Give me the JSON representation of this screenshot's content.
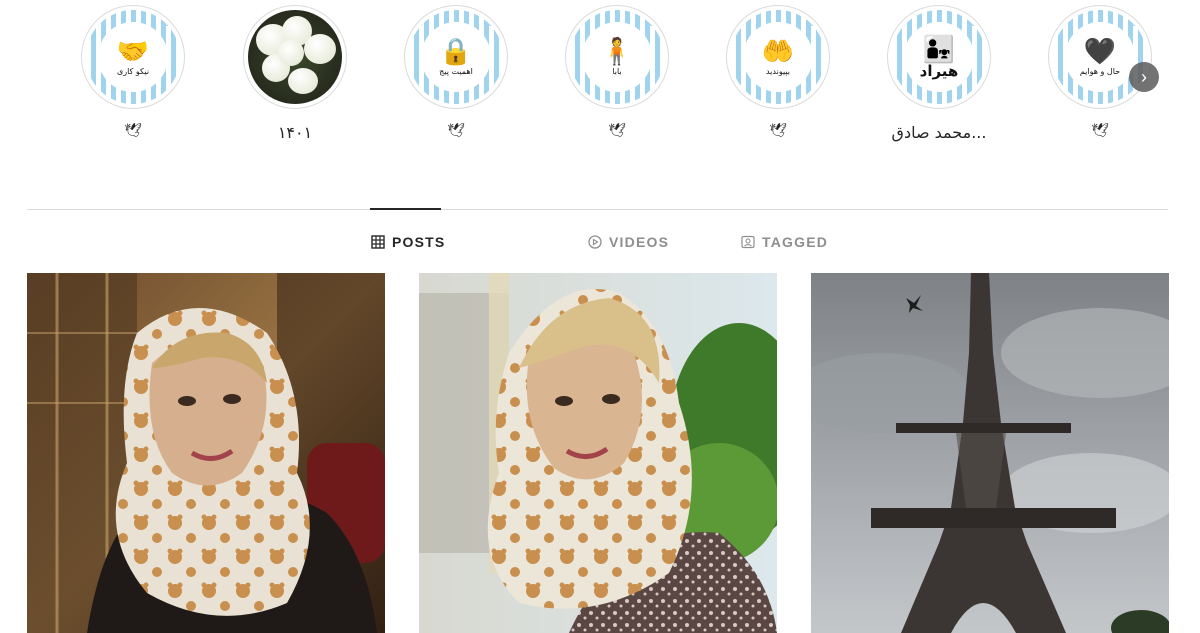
{
  "highlights": [
    {
      "label": "🕊",
      "icon": "handshake-icon",
      "glyph": "🤝",
      "sub": "نیکو کاری",
      "kind": "icon"
    },
    {
      "label": "۱۴۰۱",
      "icon": "white-flowers-photo",
      "kind": "photo"
    },
    {
      "label": "🕊",
      "icon": "lock-icon",
      "glyph": "🔒",
      "sub": "اهمیت پیج",
      "kind": "icon"
    },
    {
      "label": "🕊",
      "icon": "father-icon",
      "glyph": "🧍",
      "sub": "بابا",
      "kind": "icon"
    },
    {
      "label": "🕊",
      "icon": "hands-icon",
      "glyph": "🤲",
      "sub": "بپیوندید",
      "kind": "icon"
    },
    {
      "label": "محمد صادق...",
      "icon": "parent-child-icon",
      "glyph": "👨‍👧",
      "big": "هیراد",
      "kind": "icon"
    },
    {
      "label": "🕊",
      "icon": "heart-icon",
      "glyph": "🖤",
      "sub": "حال و هوایم",
      "kind": "icon"
    }
  ],
  "tabs": [
    {
      "label": "POSTS",
      "icon": "grid-icon",
      "active": true
    },
    {
      "label": "VIDEOS",
      "icon": "play-circle-icon",
      "active": false
    },
    {
      "label": "TAGGED",
      "icon": "tagged-portrait-icon",
      "active": false
    }
  ],
  "posts": [
    {
      "subject": "woman-in-cafe-portrait"
    },
    {
      "subject": "woman-outdoor-portrait"
    },
    {
      "subject": "eiffel-tower-photo"
    }
  ],
  "colors": {
    "stripe": "#9fd3ee",
    "divider": "#dbdbdb",
    "active_text": "#262626",
    "inactive_text": "#8e8e8e"
  }
}
